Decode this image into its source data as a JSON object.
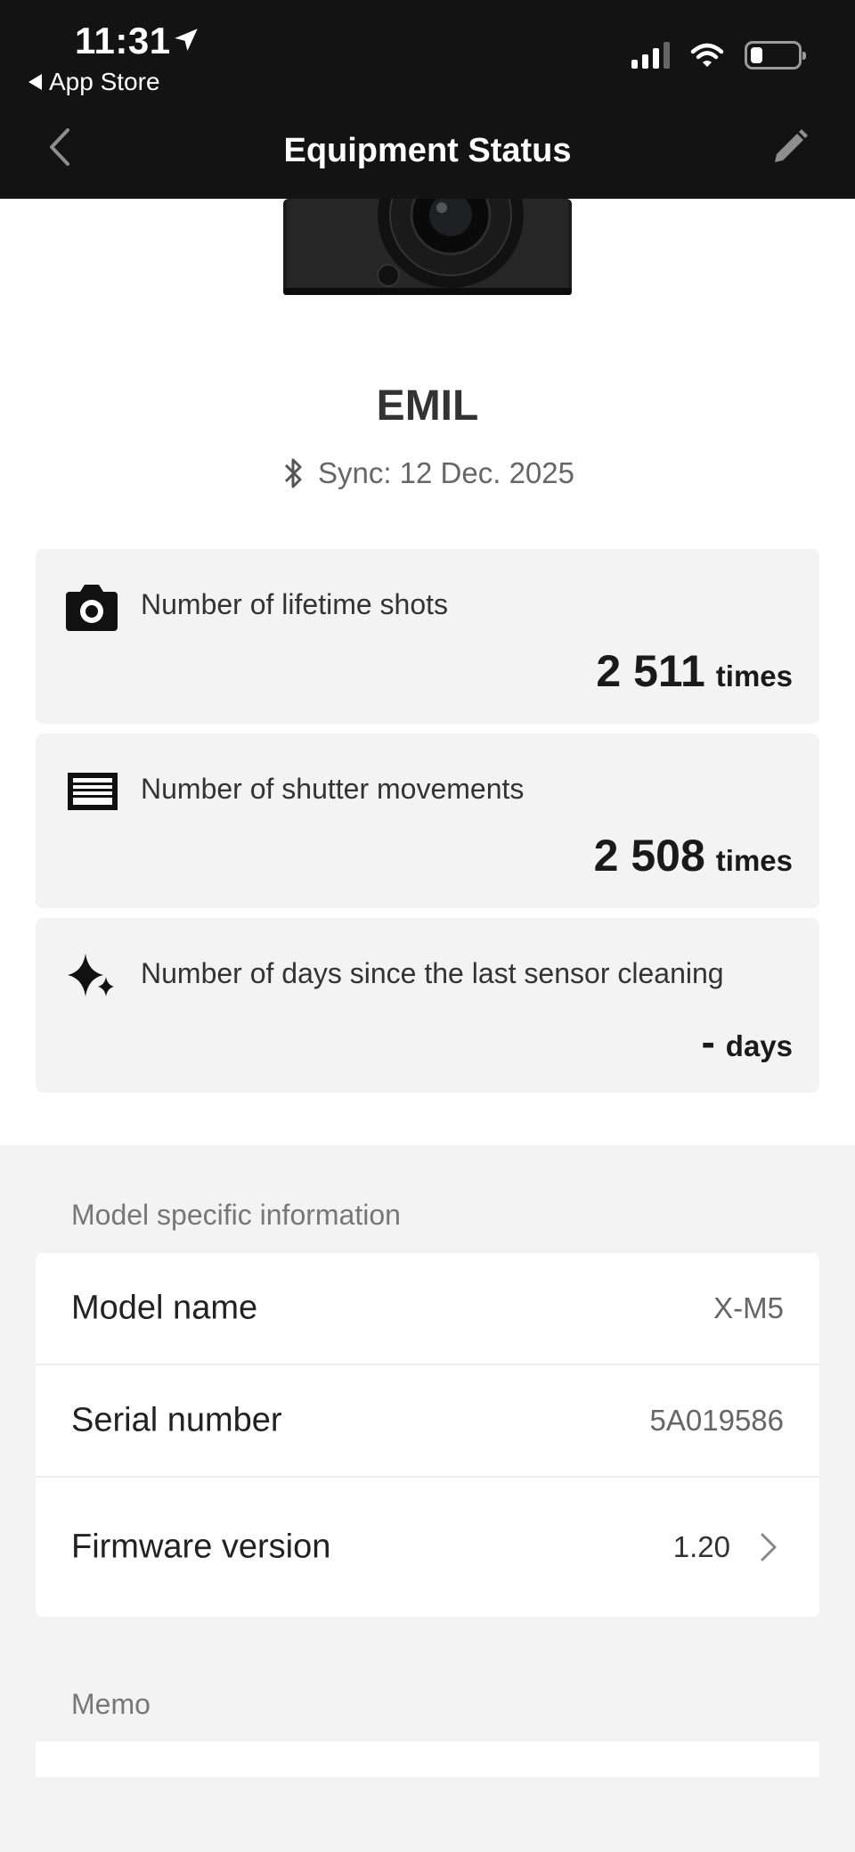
{
  "status_bar": {
    "time": "11:31",
    "back_app": "App Store"
  },
  "nav": {
    "title": "Equipment Status"
  },
  "device": {
    "name": "EMIL",
    "sync": "Sync: 12 Dec. 2025"
  },
  "stats": [
    {
      "icon": "camera-icon",
      "label": "Number of lifetime shots",
      "value": "2 511",
      "unit": "times"
    },
    {
      "icon": "shutter-icon",
      "label": "Number of shutter movements",
      "value": "2 508",
      "unit": "times"
    },
    {
      "icon": "sparkle-icon",
      "label": "Number of days since the last sensor cleaning",
      "value": "-",
      "unit": "days"
    }
  ],
  "model_info": {
    "header": "Model specific information",
    "rows": [
      {
        "key": "Model name",
        "value": "X-M5"
      },
      {
        "key": "Serial number",
        "value": "5A019586"
      },
      {
        "key": "Firmware version",
        "value": "1.20"
      }
    ]
  },
  "memo": {
    "header": "Memo"
  },
  "colors": {
    "topbar": "#131313",
    "card_bg": "#f3f3f3",
    "page_bg": "#f3f3f3"
  }
}
